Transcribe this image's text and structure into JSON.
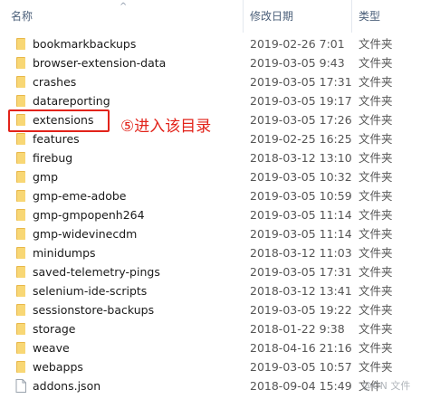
{
  "header": {
    "name_label": "名称",
    "date_label": "修改日期",
    "type_label": "类型",
    "sort_arrow": "^"
  },
  "rows": [
    {
      "name": "bookmarkbackups",
      "date": "2019-02-26 7:01",
      "type": "文件夹",
      "kind": "folder"
    },
    {
      "name": "browser-extension-data",
      "date": "2019-03-05 9:43",
      "type": "文件夹",
      "kind": "folder"
    },
    {
      "name": "crashes",
      "date": "2019-03-05 17:31",
      "type": "文件夹",
      "kind": "folder"
    },
    {
      "name": "datareporting",
      "date": "2019-03-05 19:17",
      "type": "文件夹",
      "kind": "folder"
    },
    {
      "name": "extensions",
      "date": "2019-03-05 17:26",
      "type": "文件夹",
      "kind": "folder"
    },
    {
      "name": "features",
      "date": "2019-02-25 16:25",
      "type": "文件夹",
      "kind": "folder"
    },
    {
      "name": "firebug",
      "date": "2018-03-12 13:10",
      "type": "文件夹",
      "kind": "folder"
    },
    {
      "name": "gmp",
      "date": "2019-03-05 10:32",
      "type": "文件夹",
      "kind": "folder"
    },
    {
      "name": "gmp-eme-adobe",
      "date": "2019-03-05 10:59",
      "type": "文件夹",
      "kind": "folder"
    },
    {
      "name": "gmp-gmpopenh264",
      "date": "2019-03-05 11:14",
      "type": "文件夹",
      "kind": "folder"
    },
    {
      "name": "gmp-widevinecdm",
      "date": "2019-03-05 11:14",
      "type": "文件夹",
      "kind": "folder"
    },
    {
      "name": "minidumps",
      "date": "2018-03-12 11:03",
      "type": "文件夹",
      "kind": "folder"
    },
    {
      "name": "saved-telemetry-pings",
      "date": "2019-03-05 17:31",
      "type": "文件夹",
      "kind": "folder"
    },
    {
      "name": "selenium-ide-scripts",
      "date": "2018-03-12 13:41",
      "type": "文件夹",
      "kind": "folder"
    },
    {
      "name": "sessionstore-backups",
      "date": "2019-03-05 19:22",
      "type": "文件夹",
      "kind": "folder"
    },
    {
      "name": "storage",
      "date": "2018-01-22 9:38",
      "type": "文件夹",
      "kind": "folder"
    },
    {
      "name": "weave",
      "date": "2018-04-16 21:16",
      "type": "文件夹",
      "kind": "folder"
    },
    {
      "name": "webapps",
      "date": "2019-03-05 10:57",
      "type": "文件夹",
      "kind": "folder"
    },
    {
      "name": "addons.json",
      "date": "2018-09-04 15:49",
      "type": "文件",
      "kind": "file"
    }
  ],
  "annotation": {
    "text": "⑤进入该目录",
    "color": "#e2231a"
  },
  "watermark": "@ON 文件",
  "colors": {
    "folder_fill": "#f8d775",
    "folder_back": "#e8b84a",
    "header_text": "#4c607a"
  },
  "icons": {
    "folder": "folder-icon",
    "file": "file-icon"
  }
}
